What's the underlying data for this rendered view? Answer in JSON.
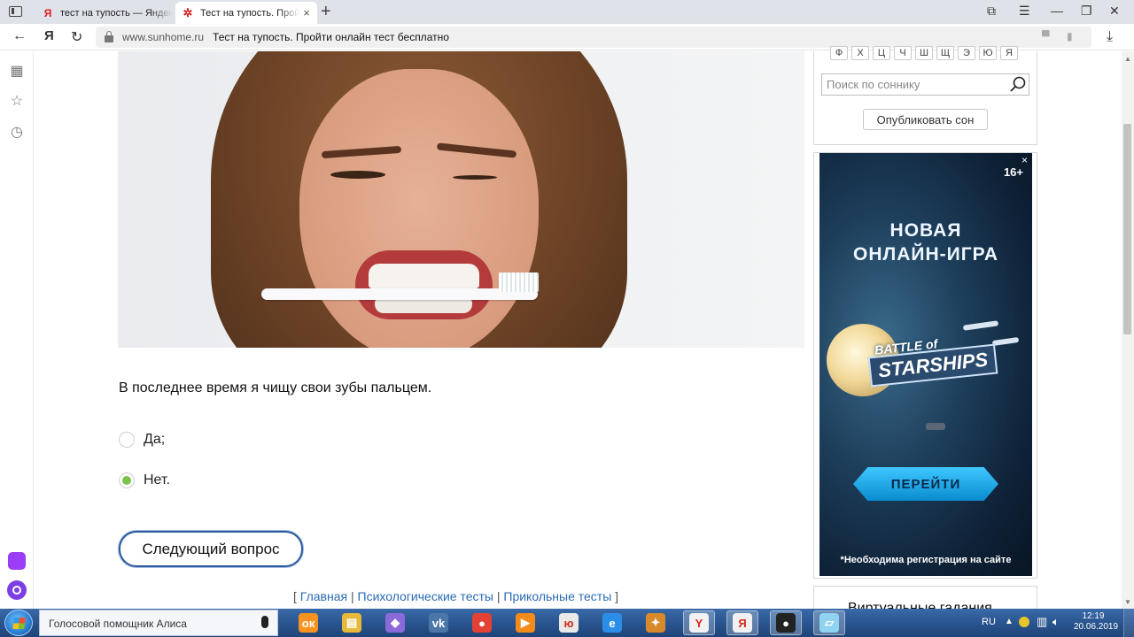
{
  "browser": {
    "tabs": [
      {
        "label": "тест на тупость — Яндекс",
        "favicon": "Я"
      },
      {
        "label": "Тест на тупость. Пройти онлайн тест бесплатно",
        "favicon": "✲"
      }
    ],
    "new_tab": "+",
    "address": {
      "domain": "www.sunhome.ru",
      "title": "Тест на тупость. Пройти онлайн тест бесплатно"
    },
    "yandex_button": "Я"
  },
  "quiz": {
    "question": "В последнее время я чищу свои зубы пальцем.",
    "options": [
      {
        "label": "Да;",
        "checked": false
      },
      {
        "label": "Нет.",
        "checked": true
      }
    ],
    "next_button": "Следующий вопрос"
  },
  "footer": {
    "open_bracket": "[",
    "links": [
      "Главная",
      "Психологические тесты",
      "Прикольные тесты"
    ],
    "separator": "|",
    "close_bracket": "]"
  },
  "dream_book": {
    "letters": [
      "Ф",
      "Х",
      "Ц",
      "Ч",
      "Ш",
      "Щ",
      "Э",
      "Ю",
      "Я"
    ],
    "search_placeholder": "Поиск по соннику",
    "publish_button": "Опубликовать сон"
  },
  "ad": {
    "close": "×",
    "age": "16+",
    "headline_1": "НОВАЯ",
    "headline_2": "ОНЛАЙН-ИГРА",
    "logo_1": "BATTLE of",
    "logo_2": "STARSHIPS",
    "cta": "ПЕРЕЙТИ",
    "note": "*Необходима регистрация на сайте"
  },
  "horoscope_box": {
    "title": "Виртуальные гадания"
  },
  "taskbar": {
    "search_label": "Голосовой помощник Алиса",
    "apps": [
      {
        "name": "odnoklassniki",
        "glyph": "ок",
        "color": "#f7931e"
      },
      {
        "name": "explorer",
        "glyph": "▤",
        "color": "#e7b93b"
      },
      {
        "name": "visual-studio",
        "glyph": "◆",
        "color": "#8a6ad8"
      },
      {
        "name": "vk",
        "glyph": "vk",
        "color": "#4a76a8"
      },
      {
        "name": "chrome",
        "glyph": "●",
        "color": "#e34133"
      },
      {
        "name": "media-player",
        "glyph": "▶",
        "color": "#f28b1a"
      },
      {
        "name": "yandex-music",
        "glyph": "ю",
        "color": "#e9e9e9"
      },
      {
        "name": "internet-explorer",
        "glyph": "e",
        "color": "#2b8ee6"
      },
      {
        "name": "counter-strike",
        "glyph": "✦",
        "color": "#d88a2a"
      },
      {
        "name": "yandex-y",
        "glyph": "Y",
        "color": "#f1f1f1"
      },
      {
        "name": "yandex-browser",
        "glyph": "Я",
        "color": "#f1f1f1"
      },
      {
        "name": "recorder",
        "glyph": "●",
        "color": "#222222"
      },
      {
        "name": "notes",
        "glyph": "▱",
        "color": "#8fd3f0"
      }
    ],
    "language": "RU",
    "time": "12:19",
    "date": "20.06.2019"
  }
}
